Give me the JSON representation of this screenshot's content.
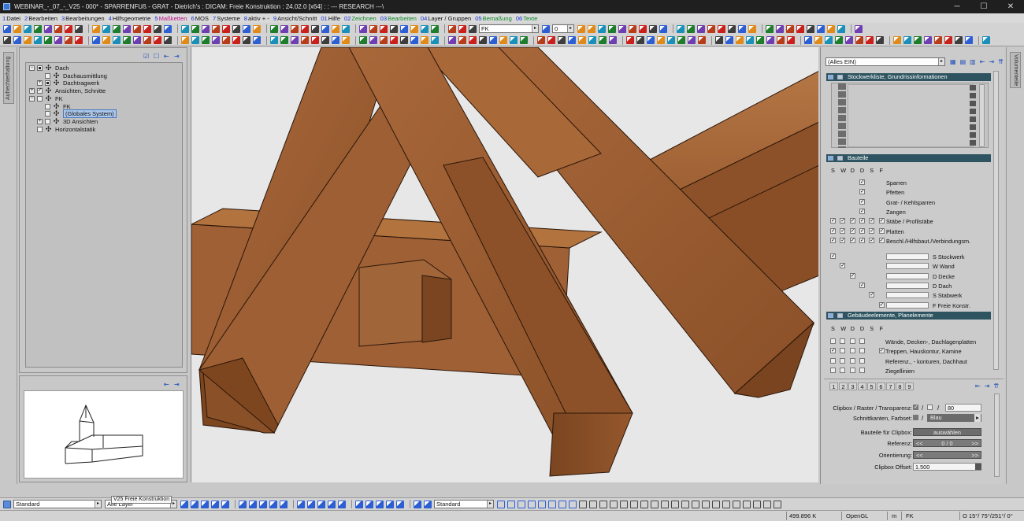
{
  "window": {
    "title": "WEBINAR_-_07_-_V25 - 000* - SPARRENFUß - GRAT - Dietrich's : DICAM: Freie Konstruktion : 24.02.0 [x64] : : --- RESEARCH ---\\",
    "minimize": "─",
    "maximize": "☐",
    "close": "✕"
  },
  "menu": [
    {
      "num": "1",
      "label": "Datei",
      "style": ""
    },
    {
      "num": "2",
      "label": "Bearbeiten",
      "style": ""
    },
    {
      "num": "3",
      "label": "Bearbeitungen",
      "style": ""
    },
    {
      "num": "4",
      "label": "Hilfsgeometrie",
      "style": ""
    },
    {
      "num": "5",
      "label": "Maßketten",
      "style": "mag"
    },
    {
      "num": "6",
      "label": "MOS",
      "style": ""
    },
    {
      "num": "7",
      "label": "Systeme",
      "style": ""
    },
    {
      "num": "8",
      "label": "aktiv + -",
      "style": ""
    },
    {
      "num": "9",
      "label": "Ansicht/Schnitt",
      "style": ""
    },
    {
      "num": "01",
      "label": "Hilfe",
      "style": ""
    },
    {
      "num": "02",
      "label": "Zeichnen",
      "style": "colored"
    },
    {
      "num": "03",
      "label": "Bearbeiten",
      "style": "colored"
    },
    {
      "num": "04",
      "label": "Layer / Gruppen",
      "style": ""
    },
    {
      "num": "05",
      "label": "Bemaßung",
      "style": "colored"
    },
    {
      "num": "06",
      "label": "Texte",
      "style": "colored"
    }
  ],
  "toolbar": {
    "layer_dropdown": "FK",
    "number_dropdown": "0"
  },
  "left_strip": {
    "tab": "Aufrechterhaltung"
  },
  "tree": {
    "items": [
      {
        "label": "Dach",
        "level": 0,
        "exp": "−",
        "cb": "sq"
      },
      {
        "label": "Dachausmittlung",
        "level": 1,
        "exp": "",
        "cb": ""
      },
      {
        "label": "Dachtragwerk",
        "level": 1,
        "exp": "+",
        "cb": "sq"
      },
      {
        "label": "Ansichten, Schnitte",
        "level": 0,
        "exp": "+",
        "cb": "ck"
      },
      {
        "label": "FK",
        "level": 0,
        "exp": "−",
        "cb": ""
      },
      {
        "label": "FK",
        "level": 1,
        "exp": "",
        "cb": ""
      },
      {
        "label": "(Globales System)",
        "level": 1,
        "exp": "",
        "cb": "",
        "selected": true
      },
      {
        "label": "3D Ansichten",
        "level": 1,
        "exp": "+",
        "cb": ""
      },
      {
        "label": "Horizontalstatik",
        "level": 0,
        "exp": "",
        "cb": ""
      }
    ]
  },
  "right_panel": {
    "filter_dropdown": "(Alles EIN)",
    "tab": "Volumenteile",
    "sections": {
      "stockwerk": "Stockwerkliste, Grundrissinformationen",
      "bauteile": "Bauteile",
      "gebaeude": "Gebäudeelemente, Planelemente"
    },
    "col_headers": [
      "S",
      "W",
      "D",
      "D",
      "S",
      "F"
    ],
    "bauteile_rows": [
      {
        "label": "Sparren",
        "checks": [
          false,
          false,
          false,
          true,
          false,
          false
        ]
      },
      {
        "label": "Pfetten",
        "checks": [
          false,
          false,
          false,
          true,
          false,
          false
        ]
      },
      {
        "label": "Grat- / Kehlsparren",
        "checks": [
          false,
          false,
          false,
          true,
          false,
          false
        ]
      },
      {
        "label": "Zangen",
        "checks": [
          false,
          false,
          false,
          true,
          false,
          false
        ]
      },
      {
        "label": "Stäbe / Profilstäbe",
        "checks": [
          true,
          true,
          true,
          true,
          true,
          true
        ]
      },
      {
        "label": "Platten",
        "checks": [
          true,
          true,
          true,
          true,
          true,
          true
        ]
      },
      {
        "label": "Beschl./Hilfsbaut./Verbindungsm.",
        "checks": [
          true,
          true,
          true,
          true,
          true,
          true
        ]
      }
    ],
    "layer_rows": [
      {
        "label": "S Stockwerk",
        "col": 0
      },
      {
        "label": "W Wand",
        "col": 1
      },
      {
        "label": "D Decke",
        "col": 2
      },
      {
        "label": "D Dach",
        "col": 3
      },
      {
        "label": "S Stabwerk",
        "col": 4
      },
      {
        "label": "F Freie Konstr.",
        "col": 5
      }
    ],
    "gebaeude_rows": [
      {
        "label": "Wände, Decken-, Dachlagenplatten",
        "checks": [
          false,
          false,
          false,
          false,
          false,
          false
        ]
      },
      {
        "label": "Treppen, Hauskontur, Kamine",
        "checks": [
          true,
          false,
          false,
          false,
          false,
          true
        ]
      },
      {
        "label": "Referenz., - konturen, Dachhaut",
        "checks": [
          false,
          false,
          false,
          false,
          false,
          false
        ]
      },
      {
        "label": "Ziegellinien",
        "checks": [
          false,
          false,
          false,
          false,
          false,
          false
        ]
      }
    ],
    "number_tabs": [
      "1",
      "2",
      "3",
      "4",
      "5",
      "6",
      "7",
      "8",
      "9"
    ],
    "clipbox": {
      "label_raster": "Clipbox / Raster / Transparenz:",
      "transparency": "80",
      "slash": "/",
      "label_schnitt": "Schnittkanten, Farbset:",
      "farbset": "Blau",
      "label_bauteile": "Bauteile für Clipbox:",
      "bauteile_btn": "auswählen",
      "label_referenz": "Referenz:",
      "referenz_prev": "<<",
      "referenz_value": "0 / 0",
      "referenz_next": ">>",
      "label_orient": "Orientierung:",
      "orient_prev": "<<",
      "orient_next": ">>",
      "label_offset": "Clipbox Offset:",
      "offset": "1.500"
    }
  },
  "bottom_toolbar": {
    "dropdown1": "Standard",
    "dropdown2": "Alle Layer",
    "dropdown3": "Standard",
    "tooltip": "V25 Freie Konstruktion"
  },
  "status": {
    "memory": "499.896 K",
    "renderer": "OpenGL",
    "unit": "m",
    "layer": "FK",
    "view": "O 15°/ 75°/251°/  0°"
  },
  "colors": {
    "section_header": "#2d5460",
    "wood": "#9a5a2c",
    "viewport_bg": "#e7e7e7"
  }
}
